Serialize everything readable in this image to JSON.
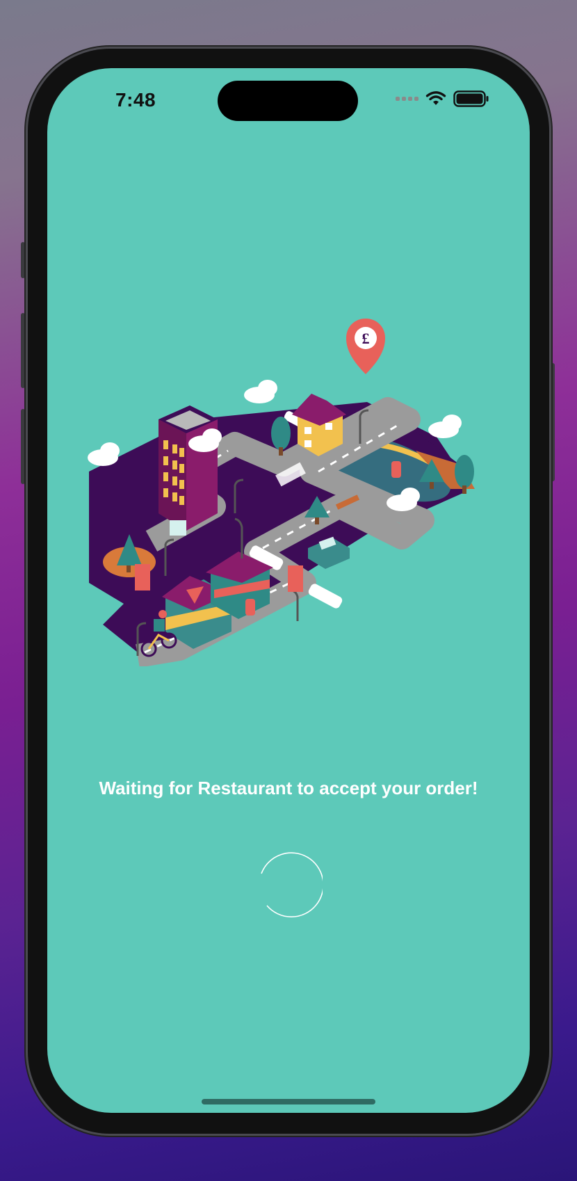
{
  "status_bar": {
    "time": "7:48"
  },
  "map": {
    "pin_symbol": "£"
  },
  "main": {
    "message": "Waiting for Restaurant to accept your order!"
  },
  "colors": {
    "screen_background": "#5dc9b9",
    "message_text": "#ffffff",
    "map_base": "#3d0c57",
    "road": "#9b9b9b",
    "pin": "#e8615a"
  },
  "icons": {
    "signal": "cellular-signal-icon",
    "wifi": "wifi-icon",
    "battery": "battery-icon",
    "pin": "location-pin-icon",
    "spinner": "loading-spinner-icon"
  }
}
